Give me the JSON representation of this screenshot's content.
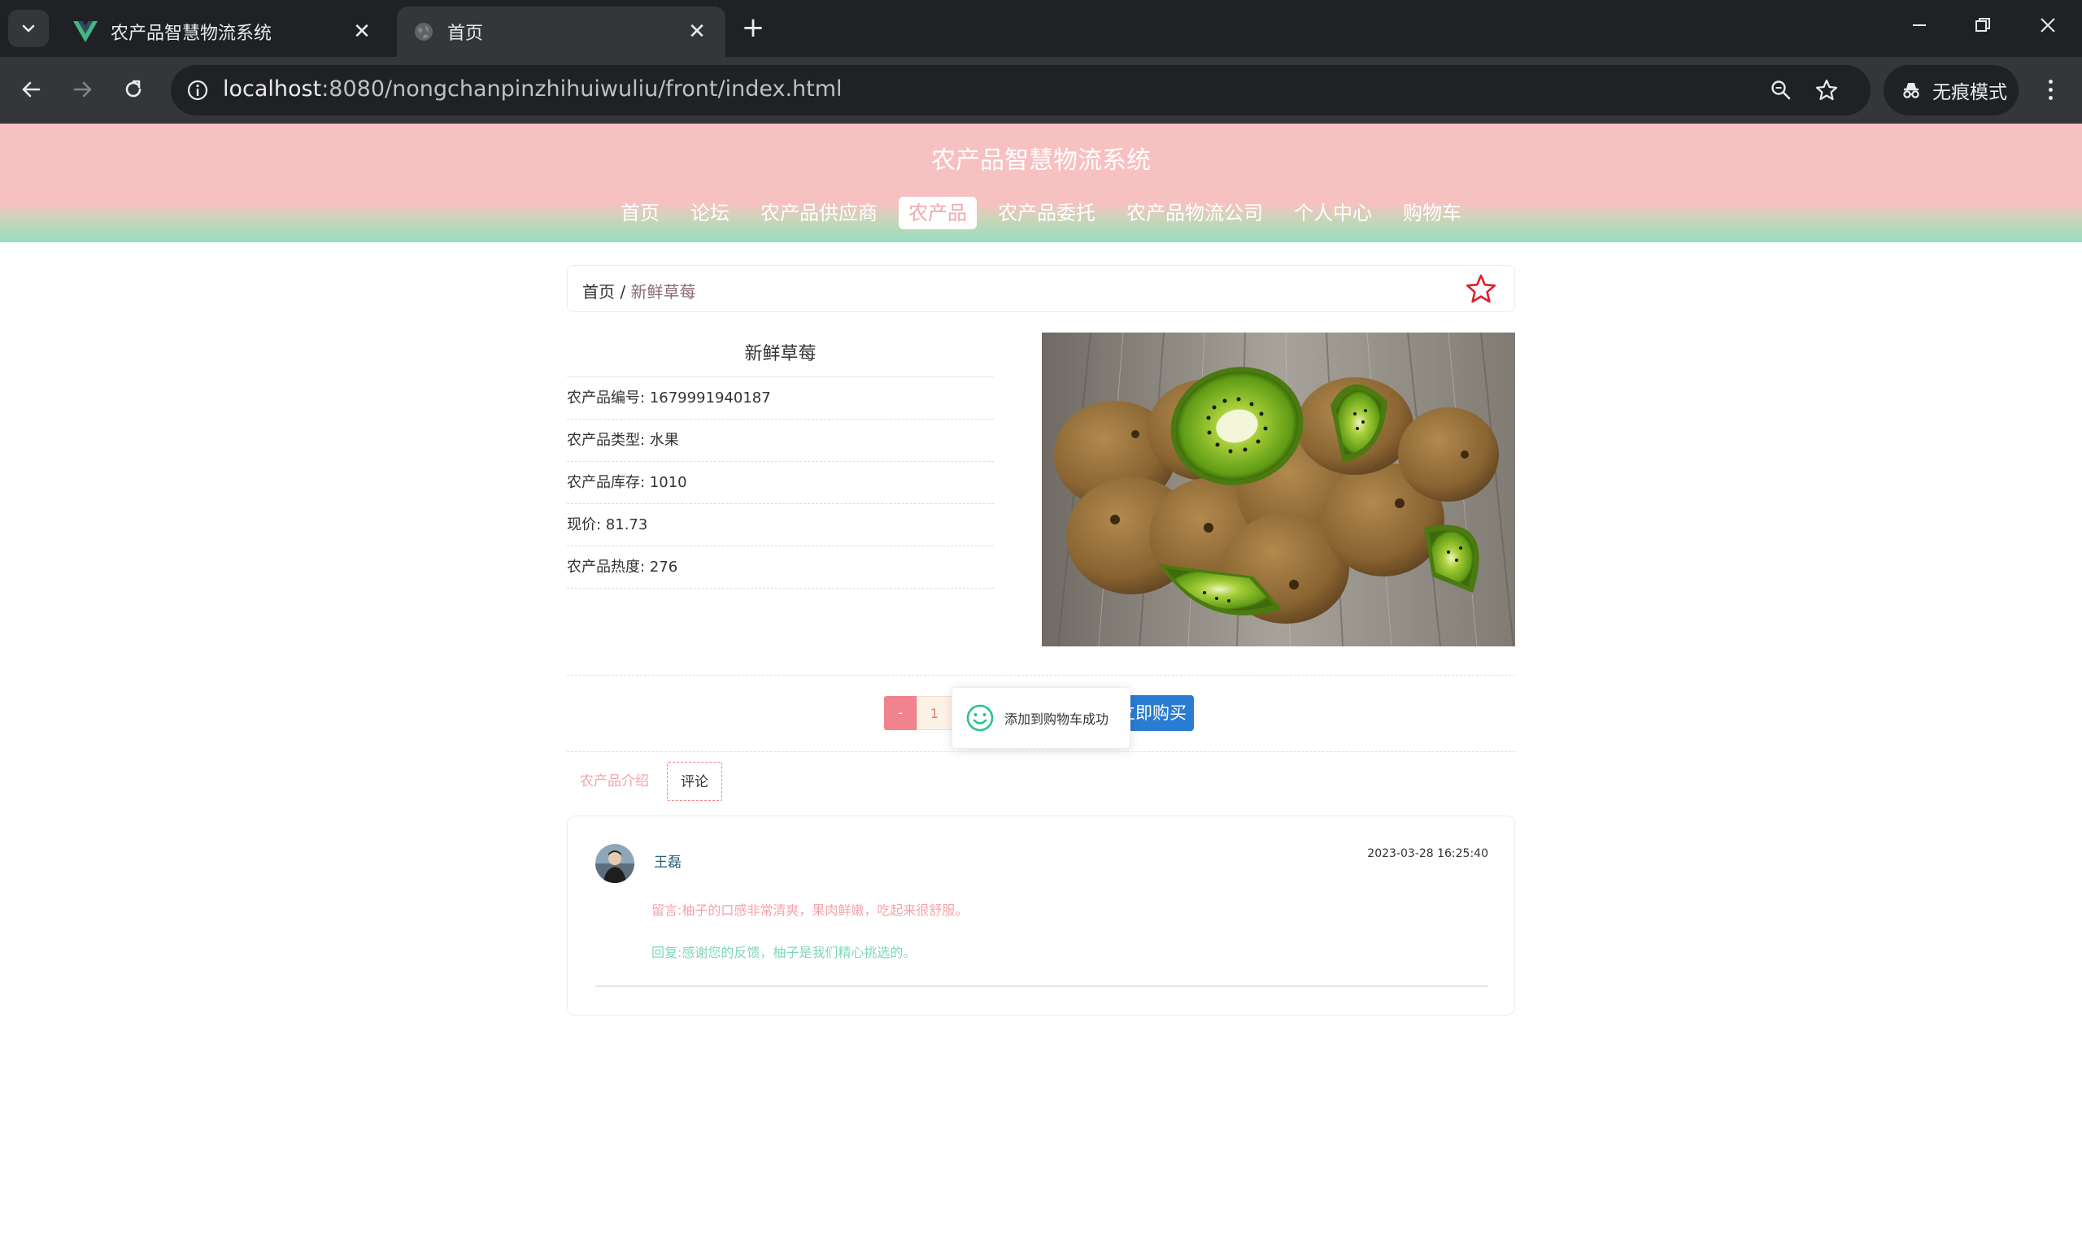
{
  "browser": {
    "tabs": [
      {
        "title": "农产品智慧物流系统",
        "active": false
      },
      {
        "title": "首页",
        "active": true
      }
    ],
    "url_host": "localhost",
    "url_path": ":8080/nongchanpinzhihuiwuliu/front/index.html",
    "incognito_label": "无痕模式"
  },
  "site": {
    "title": "农产品智慧物流系统",
    "nav": [
      {
        "label": "首页",
        "active": false
      },
      {
        "label": "论坛",
        "active": false
      },
      {
        "label": "农产品供应商",
        "active": false
      },
      {
        "label": "农产品",
        "active": true
      },
      {
        "label": "农产品委托",
        "active": false
      },
      {
        "label": "农产品物流公司",
        "active": false
      },
      {
        "label": "个人中心",
        "active": false
      },
      {
        "label": "购物车",
        "active": false
      }
    ]
  },
  "breadcrumb": {
    "home": "首页",
    "separator": " / ",
    "current": "新鲜草莓"
  },
  "product": {
    "name": "新鲜草莓",
    "fields": [
      {
        "label": "农产品编号: ",
        "value": "1679991940187"
      },
      {
        "label": "农产品类型: ",
        "value": "水果"
      },
      {
        "label": "农产品库存: ",
        "value": "1010"
      },
      {
        "label": "现价: ",
        "value": "81.73"
      },
      {
        "label": "农产品热度: ",
        "value": "276"
      }
    ],
    "image_alt": "kiwi fruit photo"
  },
  "purchase": {
    "minus_label": "-",
    "quantity": "1",
    "buy_label": "立即购买"
  },
  "toast": {
    "message": "添加到购物车成功",
    "icon": "smile-icon"
  },
  "detail_tabs": [
    {
      "label": "农产品介绍",
      "active": false
    },
    {
      "label": "评论",
      "active": true
    }
  ],
  "comments": [
    {
      "user": "王磊",
      "time": "2023-03-28 16:25:40",
      "message": "留言:柚子的口感非常清爽，果肉鲜嫩，吃起来很舒服。",
      "reply": "回复:感谢您的反馈，柚子是我们精心挑选的。"
    }
  ],
  "colors": {
    "header_pink": "#f7c1c2",
    "header_mint": "#96ddc0",
    "accent_pink": "#f0838e",
    "buy_blue": "#2a7bd2",
    "reply_green": "#7fd8b8"
  }
}
